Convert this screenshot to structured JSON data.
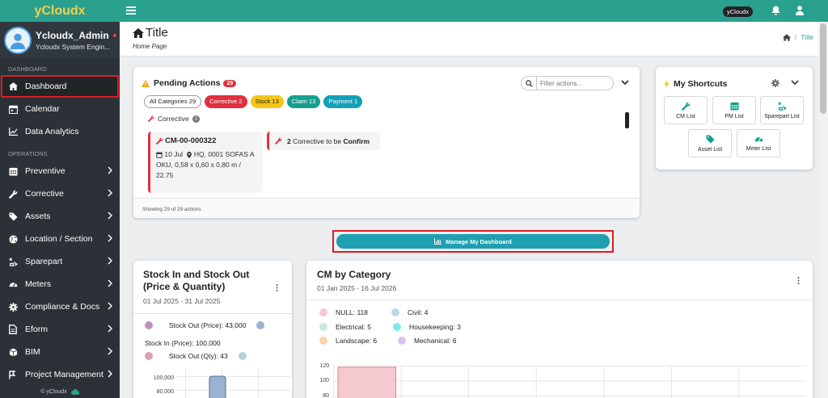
{
  "brand": "yCloudx",
  "user": {
    "name": "Ycloudx_Admin",
    "role": "Ycloudx System Engin..."
  },
  "sidebar": {
    "sections": [
      "DASHBOARD",
      "OPERATIONS"
    ],
    "dashboard_items": [
      {
        "label": "Dashboard",
        "icon": "home-icon"
      },
      {
        "label": "Calendar",
        "icon": "calendar-icon"
      },
      {
        "label": "Data Analytics",
        "icon": "line-chart-icon"
      }
    ],
    "operations_items": [
      {
        "label": "Preventive",
        "icon": "calendar-grid-icon"
      },
      {
        "label": "Corrective",
        "icon": "wrench-icon"
      },
      {
        "label": "Assets",
        "icon": "tag-icon"
      },
      {
        "label": "Location / Section",
        "icon": "globe-icon"
      },
      {
        "label": "Sparepart",
        "icon": "sparepart-icon"
      },
      {
        "label": "Meters",
        "icon": "gauge-icon"
      },
      {
        "label": "Compliance & Docs",
        "icon": "gear-icon"
      },
      {
        "label": "Eform",
        "icon": "form-icon"
      },
      {
        "label": "BIM",
        "icon": "cube-icon"
      },
      {
        "label": "Project Management",
        "icon": "project-icon"
      }
    ],
    "footer": "© yCloudx"
  },
  "topbar": {
    "badge": "yCloudx"
  },
  "header": {
    "title": "Title",
    "subtitle": "Home Page",
    "breadcrumb_sep": "/",
    "breadcrumb_current": "Title"
  },
  "pending": {
    "title": "Pending Actions",
    "count": "29",
    "filter_placeholder": "Filter actions...",
    "categories": [
      {
        "label": "All Categories 29",
        "style": "all"
      },
      {
        "label": "Corrective 2",
        "style": "c"
      },
      {
        "label": "Stock 13",
        "style": "s"
      },
      {
        "label": "Claim 13",
        "style": "cl"
      },
      {
        "label": "Payment 1",
        "style": "p"
      }
    ],
    "group_label": "Corrective",
    "group_count": "2",
    "action1": {
      "id": "CM-00-000322",
      "date": "10 Jul",
      "location": "HQ, 0001 SOFAS",
      "desc": "A OKU, 0,58 x 0,60 x 0,80 m / 22.75"
    },
    "action2": {
      "count": "2",
      "text": "Corrective to be",
      "status": "Confirm"
    },
    "footer": "Showing 29 of 29 actions"
  },
  "shortcuts": {
    "title": "My Shortcuts",
    "items": [
      {
        "label": "CM List",
        "icon": "wrench-icon"
      },
      {
        "label": "PM List",
        "icon": "calendar-grid-icon"
      },
      {
        "label": "Sparepart List",
        "icon": "sparepart-icon"
      },
      {
        "label": "Asset List",
        "icon": "tag-icon"
      },
      {
        "label": "Meter List",
        "icon": "gauge-icon"
      }
    ]
  },
  "manage_button": "Manage My Dashboard",
  "stock_card": {
    "title": "Stock In and Stock Out (Price & Quantity)",
    "date_range": "01 Jul 2025 - 31 Jul 2025",
    "legend": [
      "Stock Out (Price): 43,000",
      "Stock In (Price): 100,000",
      "Stock Out (Qty): 43"
    ],
    "y_ticks": [
      "100,000",
      "80,000"
    ]
  },
  "cm_card": {
    "title": "CM by Category",
    "date_range": "01 Jan 2025 - 16 Jul 2026",
    "y_ticks": [
      "120",
      "100",
      "80"
    ]
  },
  "chart_data": [
    {
      "type": "bar",
      "title": "Stock In and Stock Out (Price & Quantity)",
      "series": [
        {
          "name": "Stock Out (Price)",
          "value": 43000,
          "color": "#c08fc0"
        },
        {
          "name": "Stock In (Price)",
          "value": 100000,
          "color": "#9ab3d3"
        },
        {
          "name": "Stock Out (Qty)",
          "value": 43,
          "color": "#d9a3b5"
        }
      ],
      "ylim": [
        0,
        120000
      ]
    },
    {
      "type": "bar",
      "title": "CM by Category",
      "categories": [
        "NULL",
        "Civil",
        "Electrical",
        "Housekeeping",
        "Landscape",
        "Mechanical"
      ],
      "values": [
        118,
        4,
        5,
        3,
        6,
        6
      ],
      "colors": [
        "#f4c9cf",
        "#bcd9e2",
        "#c8ecd6",
        "#7be9ee",
        "#fbd2ad",
        "#dcc2e9"
      ],
      "ylim": [
        0,
        120
      ]
    }
  ],
  "colors": {
    "accent": "#2aa08f",
    "danger": "#e0303f",
    "sidebar": "#2b3136",
    "button": "#1f9fb0"
  }
}
